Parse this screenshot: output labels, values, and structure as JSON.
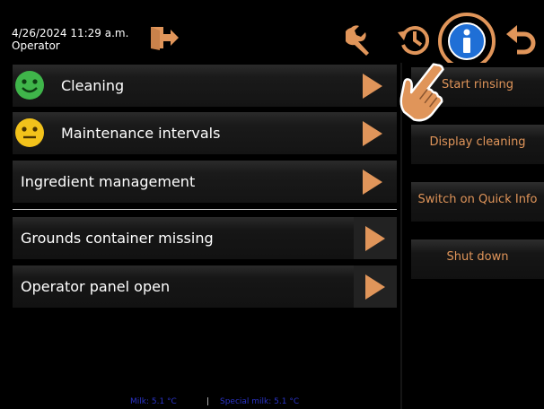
{
  "header": {
    "datetime": "4/26/2024 11:29 a.m.",
    "user": "Operator",
    "icons": [
      "logout-icon",
      "wrench-icon",
      "history-icon",
      "info-icon",
      "back-icon"
    ]
  },
  "menu": {
    "items": [
      {
        "label": "Cleaning",
        "status_icon": "smiley-happy-icon"
      },
      {
        "label": "Maintenance intervals",
        "status_icon": "smiley-neutral-icon"
      },
      {
        "label": "Ingredient management"
      }
    ],
    "messages": [
      {
        "label": "Grounds container missing"
      },
      {
        "label": "Operator panel open"
      }
    ]
  },
  "side_menu": {
    "buttons": [
      "Start rinsing",
      "Display cleaning",
      "Switch on Quick Info",
      "Shut down"
    ]
  },
  "status_bar": {
    "milk": "Milk: 5.1 °C",
    "separator": "|",
    "special_milk": "Special milk: 5.1 °C"
  },
  "colors": {
    "accent": "#e0955a",
    "info_blue": "#1f6fd6",
    "happy_green": "#3fb54a",
    "neutral_yellow": "#f2c21b",
    "status_blue": "#2b34c8"
  }
}
